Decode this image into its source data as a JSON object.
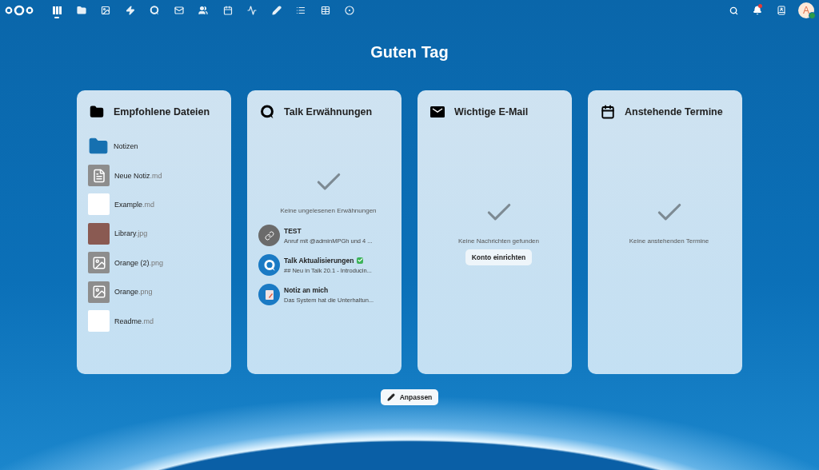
{
  "header": {
    "apps": [
      {
        "kind": "dashboard",
        "selected": true
      },
      {
        "kind": "files",
        "selected": false
      },
      {
        "kind": "photos",
        "selected": false
      },
      {
        "kind": "activity",
        "selected": false
      },
      {
        "kind": "talk",
        "selected": false
      },
      {
        "kind": "mail",
        "selected": false
      },
      {
        "kind": "contacts",
        "selected": false
      },
      {
        "kind": "calendar",
        "selected": false
      },
      {
        "kind": "analytics",
        "selected": false
      },
      {
        "kind": "notes",
        "selected": false
      },
      {
        "kind": "tasks",
        "selected": false
      },
      {
        "kind": "tables",
        "selected": false
      },
      {
        "kind": "circle",
        "selected": false
      }
    ],
    "notifications_unread": true,
    "avatar": {
      "initial": "A",
      "online": true
    }
  },
  "greeting": "Guten Tag",
  "widgets": [
    {
      "kind": "files",
      "title": "Empfohlene Dateien",
      "items": [
        {
          "kind": "folder",
          "name": "Notizen"
        },
        {
          "kind": "text",
          "name": "Neue Notiz",
          "ext": ".md"
        },
        {
          "kind": "document",
          "name": "Example",
          "ext": ".md"
        },
        {
          "kind": "photo",
          "name": "Library",
          "ext": ".jpg"
        },
        {
          "kind": "image",
          "name": "Orange (2)",
          "ext": ".png"
        },
        {
          "kind": "image",
          "name": "Orange",
          "ext": ".png"
        },
        {
          "kind": "document",
          "name": "Readme",
          "ext": ".md"
        }
      ]
    },
    {
      "kind": "talk",
      "title": "Talk Erwähnungen",
      "empty_text": "Keine ungelesenen Erwähnungen",
      "items": [
        {
          "kind": "link",
          "name": "TEST",
          "verified": false,
          "subtitle": "Anruf mit @adminMPGh und 4 ..."
        },
        {
          "kind": "talk",
          "name": "Talk Aktualisierungen",
          "verified": true,
          "subtitle": "## Neu in Talk 20.1 - Introducin..."
        },
        {
          "kind": "note",
          "name": "Notiz an mich",
          "verified": false,
          "subtitle": "Das System hat die Unterhaltun..."
        }
      ]
    },
    {
      "kind": "mail",
      "title": "Wichtige E-Mail",
      "empty_text": "Keine Nachrichten gefunden",
      "button": "Konto einrichten"
    },
    {
      "kind": "calendar",
      "title": "Anstehende Termine",
      "empty_text": "Keine anstehenden Termine"
    }
  ],
  "customize_button": "Anpassen"
}
